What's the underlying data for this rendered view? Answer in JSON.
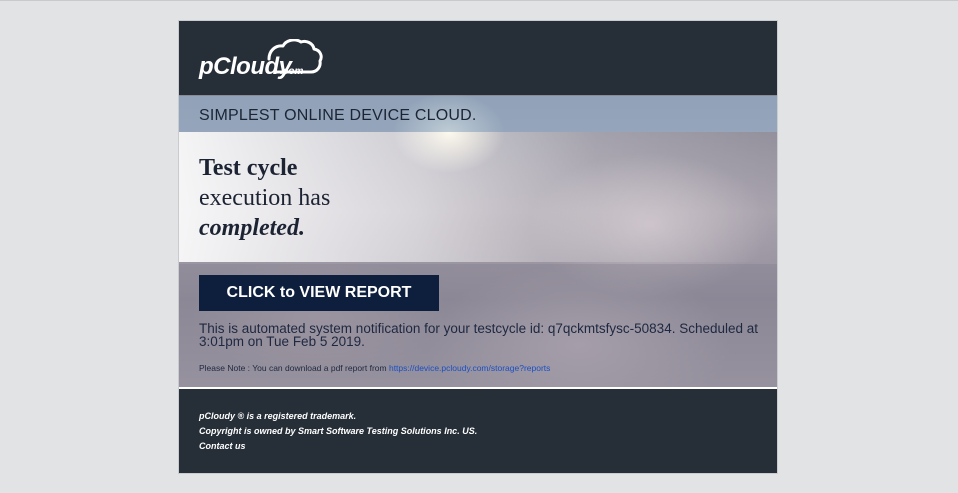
{
  "header": {
    "logo_main": "pCloudy",
    "logo_suffix": ".com"
  },
  "hero": {
    "tagline": "SIMPLEST ONLINE DEVICE CLOUD.",
    "headline_line1": "Test cycle",
    "headline_line2": "execution has",
    "headline_line3": "completed."
  },
  "cta": {
    "label": "CLICK to VIEW REPORT"
  },
  "notice": {
    "text": "This is automated system notification for your testcycle id: q7qckmtsfysc-50834. Scheduled at 3:01pm on Tue Feb 5 2019.",
    "pdf_prefix": "Please Note : You can download a pdf report from ",
    "pdf_link": "https://device.pcloudy.com/storage?reports"
  },
  "footer": {
    "trademark": "pCloudy ® is a registered trademark.",
    "copyright": "Copyright is owned by Smart Software Testing Solutions Inc. US.",
    "contact": "Contact us"
  },
  "colors": {
    "header_bg": "#262e38",
    "cta_bg": "#0e1f3d",
    "link": "#1a4fc4",
    "page_bg": "#e2e3e5"
  },
  "icons": {
    "logo": "cloud-logo-icon"
  }
}
